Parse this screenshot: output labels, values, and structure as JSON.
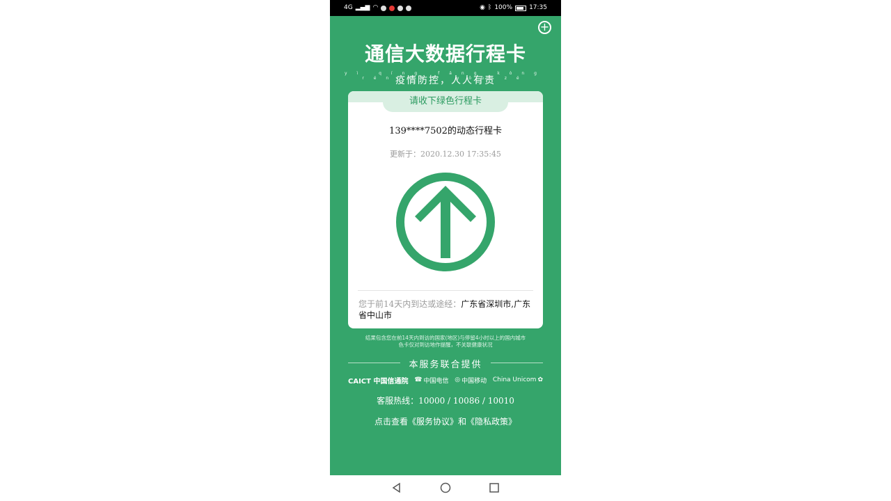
{
  "status_bar": {
    "left_signal": "4G",
    "battery": "100%",
    "time": "17:35"
  },
  "header": {
    "title": "通信大数据行程卡",
    "subtitle": "疫情防控，人人有责",
    "subtitle_pinyin": "yì qíng fáng kòng rén rén yǒu zé"
  },
  "card": {
    "tab_label": "请收下绿色行程卡",
    "phone_line": "139****7502的动态行程卡",
    "updated": "更新于：2020.12.30 17:35:45",
    "travel_prefix": "您于前14天内到达或途经：",
    "travel_places": "广东省深圳市,广东省中山市"
  },
  "notice": {
    "line1": "结果包含您在前14天内到访的国家(地区)与停留4小时以上的国内城市",
    "line2": "色卡仅对到访地作提醒，不关联健康状况"
  },
  "providers": {
    "label": "本服务联合提供",
    "logos": [
      {
        "name": "CAICT 中国信通院"
      },
      {
        "name": "中国电信"
      },
      {
        "name": "中国移动"
      },
      {
        "name": "China Unicom"
      }
    ]
  },
  "footer": {
    "hotline": "客服热线：10000 / 10086 / 10010",
    "links": "点击查看《服务协议》和《隐私政策》"
  },
  "colors": {
    "brand_green": "#35a56b",
    "tab_bg": "#d9efe2"
  }
}
